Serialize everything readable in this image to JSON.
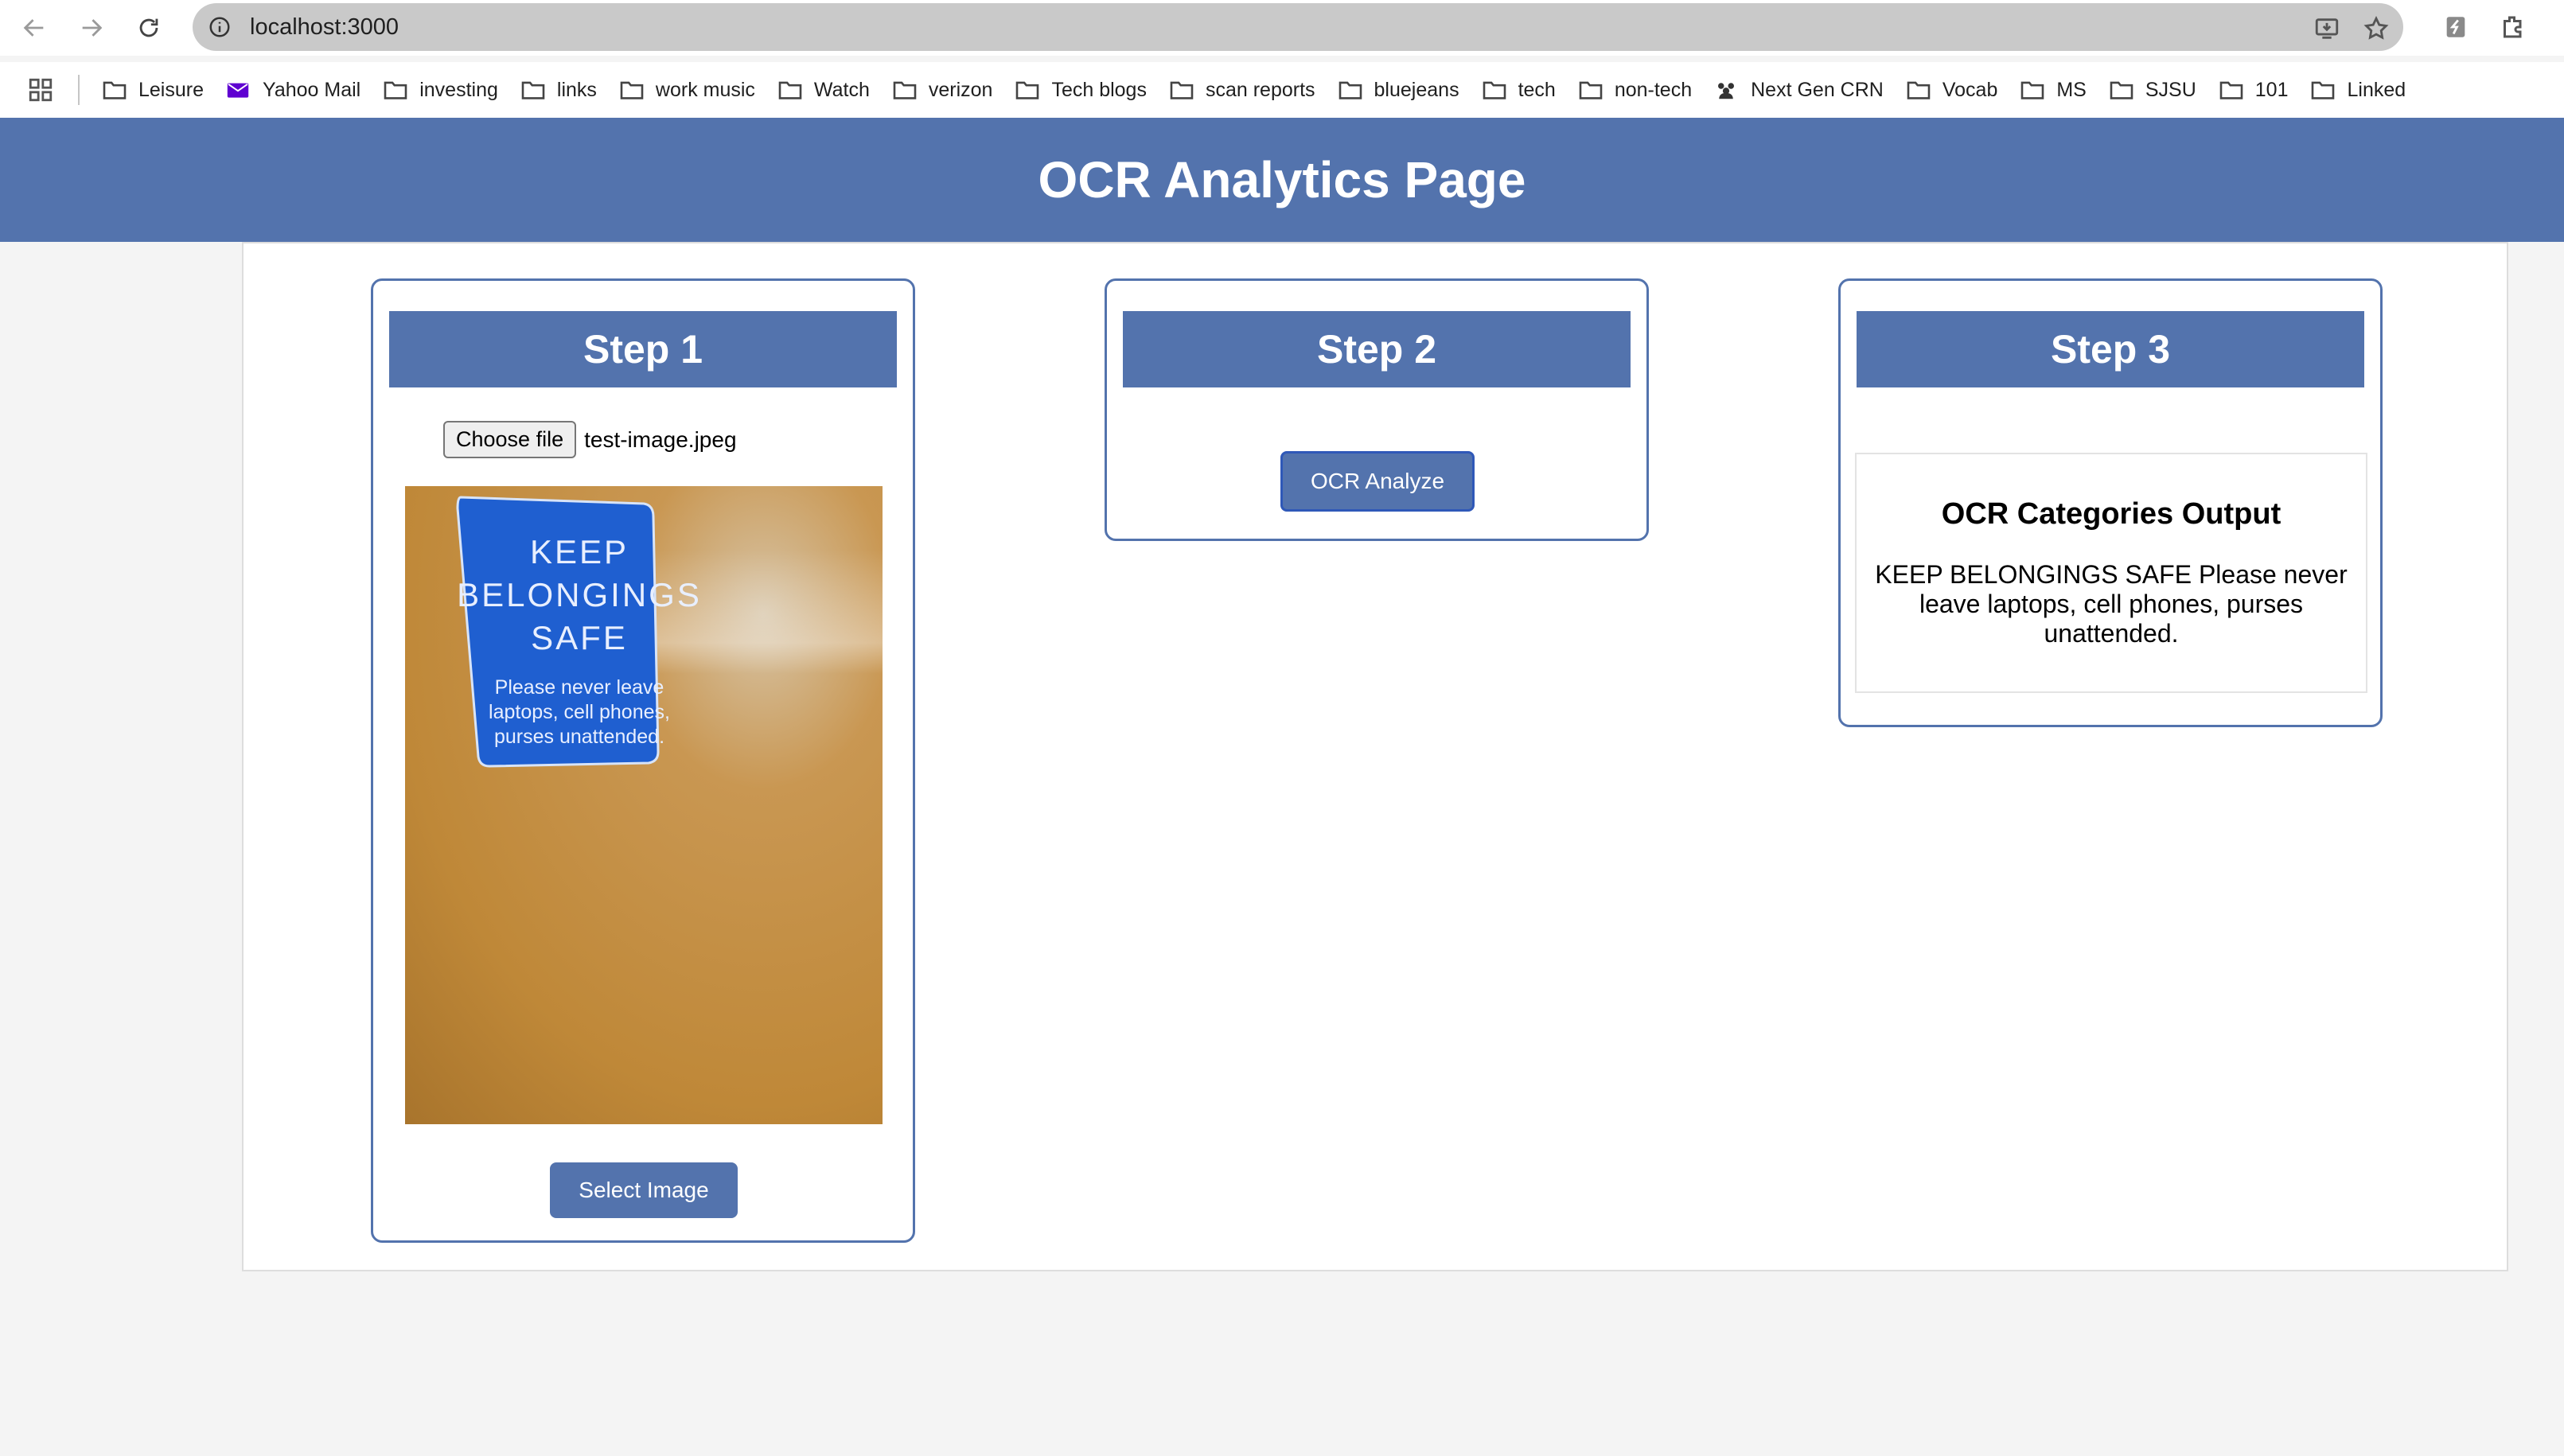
{
  "browser": {
    "url": "localhost:3000",
    "bookmarks": [
      {
        "label": "Leisure",
        "icon": "folder-icon"
      },
      {
        "label": "Yahoo Mail",
        "icon": "yahoo-mail-icon"
      },
      {
        "label": "investing",
        "icon": "folder-icon"
      },
      {
        "label": "links",
        "icon": "folder-icon"
      },
      {
        "label": "work music",
        "icon": "folder-icon"
      },
      {
        "label": "Watch",
        "icon": "folder-icon"
      },
      {
        "label": "verizon",
        "icon": "folder-icon"
      },
      {
        "label": "Tech blogs",
        "icon": "folder-icon"
      },
      {
        "label": "scan reports",
        "icon": "folder-icon"
      },
      {
        "label": "bluejeans",
        "icon": "folder-icon"
      },
      {
        "label": "tech",
        "icon": "folder-icon"
      },
      {
        "label": "non-tech",
        "icon": "folder-icon"
      },
      {
        "label": "Next Gen CRN",
        "icon": "group-icon"
      },
      {
        "label": "Vocab",
        "icon": "folder-icon"
      },
      {
        "label": "MS",
        "icon": "folder-icon"
      },
      {
        "label": "SJSU",
        "icon": "folder-icon"
      },
      {
        "label": "101",
        "icon": "folder-icon"
      },
      {
        "label": "Linked",
        "icon": "folder-icon"
      }
    ]
  },
  "header": {
    "title": "OCR Analytics Page"
  },
  "step1": {
    "title": "Step 1",
    "choose_file_label": "Choose file",
    "file_name": "test-image.jpeg",
    "sign_headline": "KEEP\nBELONGINGS\nSAFE",
    "sign_body": "Please never leave\nlaptops, cell phones,\npurses unattended.",
    "select_button_label": "Select Image"
  },
  "step2": {
    "title": "Step 2",
    "analyze_button_label": "OCR Analyze"
  },
  "step3": {
    "title": "Step 3",
    "output_title": "OCR Categories Output",
    "output_text": "KEEP BELONGINGS SAFE Please never leave laptops, cell phones, purses unattended."
  },
  "colors": {
    "accent": "#5373ad",
    "sign_blue": "#1f5fd0",
    "cork": "#c08a3e"
  }
}
